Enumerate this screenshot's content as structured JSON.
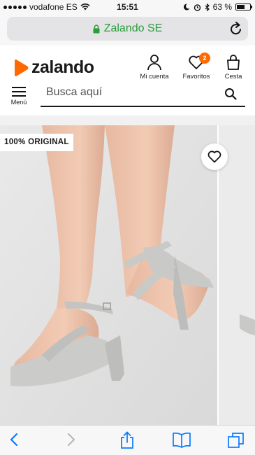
{
  "status_bar": {
    "carrier": "vodafone ES",
    "time": "15:51",
    "battery": "63 %",
    "battery_level": 0.63
  },
  "browser": {
    "domain": "Zalando SE"
  },
  "header": {
    "logo_text": "zalando",
    "account_label": "Mi cuenta",
    "favorites_label": "Favoritos",
    "favorites_count": "2",
    "cart_label": "Cesta",
    "menu_label": "Menú",
    "search_placeholder": "Busca aquí"
  },
  "product": {
    "badge": "100% ORIGINAL"
  },
  "colors": {
    "brand_orange": "#ff6900",
    "secure_green": "#2a9d3b",
    "ios_blue": "#0a7aff"
  },
  "icons": [
    "lock-icon",
    "reload-icon",
    "person-icon",
    "heart-icon",
    "bag-icon",
    "hamburger-icon",
    "search-icon",
    "back-icon",
    "forward-icon",
    "share-icon",
    "bookmarks-icon",
    "tabs-icon"
  ]
}
